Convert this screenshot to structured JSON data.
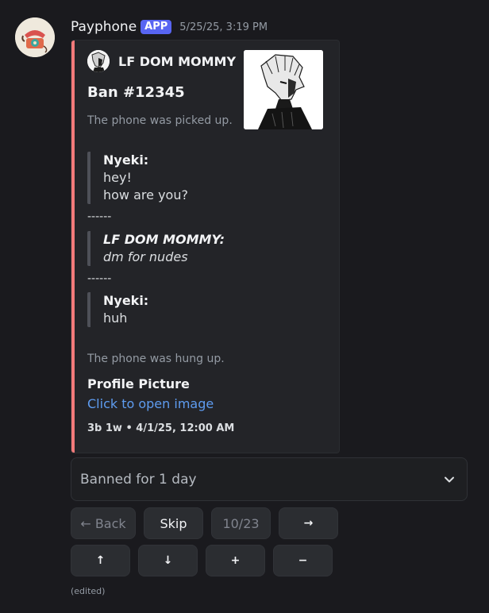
{
  "message": {
    "username": "Payphone",
    "badge": "APP",
    "timestamp": "5/25/25, 3:19 PM",
    "avatar_icon": "telephone-icon",
    "edited_label": "(edited)"
  },
  "embed": {
    "accent_color": "#f27a7a",
    "author": "LF DOM MOMMY",
    "title": "Ban #12345",
    "picked_up": "The phone was picked up.",
    "conversation": [
      {
        "speaker": "Nyeki:",
        "lines": [
          "hey!",
          "how are you?"
        ],
        "italic": false
      },
      {
        "speaker": "LF DOM MOMMY:",
        "lines": [
          "dm for nudes"
        ],
        "italic": true
      },
      {
        "speaker": "Nyeki:",
        "lines": [
          "huh"
        ],
        "italic": false
      }
    ],
    "separator": "------",
    "hung_up": "The phone was hung up.",
    "field_name": "Profile Picture",
    "field_link": "Click to open image",
    "footer": "3b 1w • 4/1/25, 12:00 AM"
  },
  "select": {
    "value": "Banned for 1 day"
  },
  "buttons": {
    "back": "← Back",
    "skip": "Skip",
    "page": "10/23",
    "next": "→",
    "up": "↑",
    "down": "↓",
    "plus": "+",
    "minus": "−"
  }
}
